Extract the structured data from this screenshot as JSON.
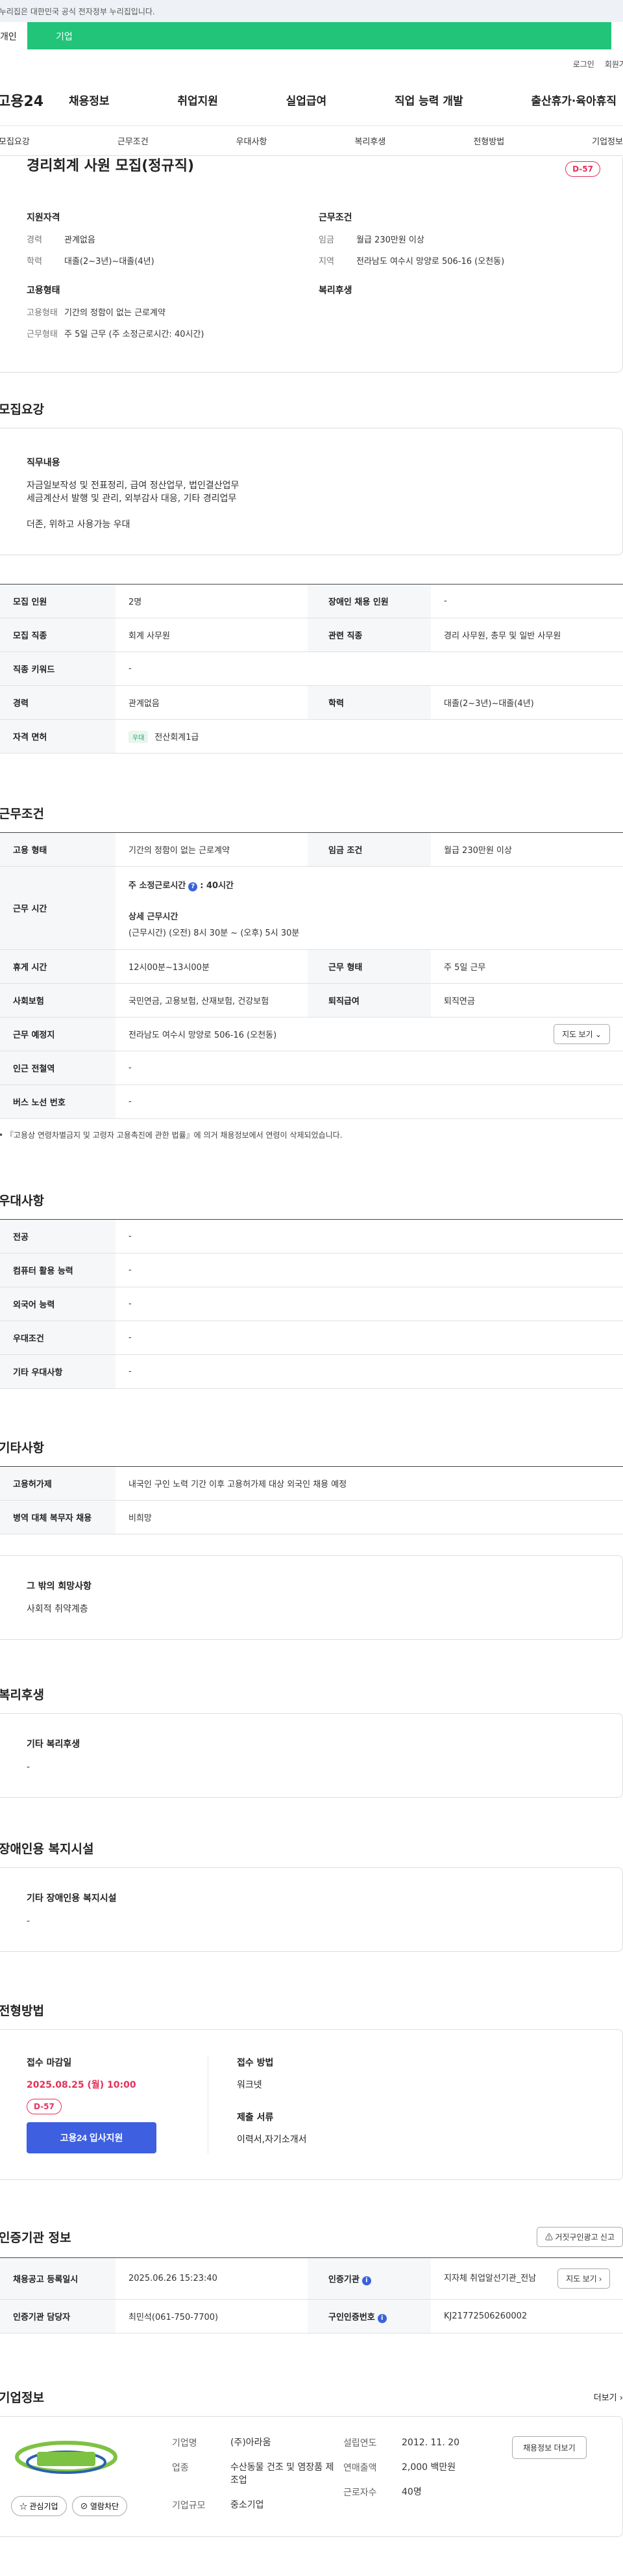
{
  "gov_banner": "이 누리집은 대한민국 공식 전자정부 누리집입니다.",
  "user_tabs": [
    "개인",
    "기업"
  ],
  "util_links": [
    "로그인",
    "회원가입"
  ],
  "gnb": {
    "logo": "고용24",
    "menu": [
      "채용정보",
      "취업지원",
      "실업급여",
      "직업 능력 개발",
      "출산휴가·육아휴직"
    ]
  },
  "subnav": [
    "모집요강",
    "근무조건",
    "우대사항",
    "복리후생",
    "전형방법",
    "기업정보"
  ],
  "summary": {
    "title": "경리회계 사원 모집(정규직)",
    "dday": "D-57",
    "qualification": {
      "heading": "지원자격",
      "rows": [
        {
          "k": "경력",
          "v": "관계없음"
        },
        {
          "k": "학력",
          "v": "대졸(2~3년)~대졸(4년)"
        }
      ]
    },
    "employment": {
      "heading": "고용형태",
      "rows": [
        {
          "k": "고용형태",
          "v": "기간의 정함이 없는 근로계약"
        },
        {
          "k": "근무형태",
          "v": "주 5일 근무 (주 소정근로시간: 40시간)"
        }
      ]
    },
    "conditions": {
      "heading": "근무조건",
      "rows": [
        {
          "k": "임금",
          "v": "월급 230만원 이상"
        },
        {
          "k": "지역",
          "v": "전라남도 여수시 망양로 506-16 (오천동)"
        }
      ]
    },
    "welfare": {
      "heading": "복리후생"
    }
  },
  "recruit": {
    "section_title": "모집요강",
    "job_head": "직무내용",
    "job_text": [
      "자금일보작성 및 전표정리, 급여 정산업무, 법인결산업무",
      "세금계산서 발행 및 관리, 외부감사 대응, 기타 경리업무",
      "",
      "더존, 위하고 사용가능 우대"
    ],
    "rows": [
      [
        {
          "th": "모집 인원",
          "td": "2명"
        },
        {
          "th": "장애인 채용 인원",
          "td": "-"
        }
      ],
      [
        {
          "th": "모집 직종",
          "td": "회계 사무원"
        },
        {
          "th": "관련 직종",
          "td": "경리 사무원, 총무 및 일반 사무원"
        }
      ],
      [
        {
          "th": "직종 키워드",
          "td": "-"
        }
      ],
      [
        {
          "th": "경력",
          "td": "관계없음"
        },
        {
          "th": "학력",
          "td": "대졸(2~3년)~대졸(4년)"
        }
      ],
      [
        {
          "th": "자격 면허",
          "td": "전산회계1급",
          "tag": "우대"
        }
      ]
    ]
  },
  "work": {
    "section_title": "근무조건",
    "employ_type": {
      "th": "고용 형태",
      "td": "기간의 정함이 없는 근로계약"
    },
    "wage": {
      "th": "임금 조건",
      "td": "월급 230만원 이상"
    },
    "hours": {
      "th": "근무 시간",
      "weekly_label": "주 소정근로시간",
      "weekly_value": ": 40시간",
      "detail_label": "상세 근무시간",
      "detail_value": "(근무시간) (오전) 8시 30분 ~ (오후) 5시 30분"
    },
    "break": {
      "th": "휴게 시간",
      "td": "12시00분~13시00분"
    },
    "work_form": {
      "th": "근무 형태",
      "td": "주 5일 근무"
    },
    "insurance": {
      "th": "사회보험",
      "td": "국민연금, 고용보험, 산재보험, 건강보험"
    },
    "retire": {
      "th": "퇴직급여",
      "td": "퇴직연금"
    },
    "place": {
      "th": "근무 예정지",
      "td": "전라남도 여수시 망양로 506-16 (오천동)",
      "btn": "지도 보기"
    },
    "subway": {
      "th": "인근 전철역",
      "td": "-"
    },
    "bus": {
      "th": "버스 노선 번호",
      "td": "-"
    },
    "notice": "『고용상 연령차별금지 및 고령자 고용촉진에 관한 법률』에 의거 채용정보에서 연령이 삭제되었습니다."
  },
  "preference": {
    "section_title": "우대사항",
    "rows": [
      {
        "th": "전공",
        "td": "-"
      },
      {
        "th": "컴퓨터 활용 능력",
        "td": "-"
      },
      {
        "th": "외국어 능력",
        "td": "-"
      },
      {
        "th": "우대조건",
        "td": "-"
      },
      {
        "th": "기타 우대사항",
        "td": "-"
      }
    ]
  },
  "etc": {
    "section_title": "기타사항",
    "rows": [
      {
        "th": "고용허가제",
        "td": "내국인 구인 노력 기간 이후 고용허가제 대상 외국인 채용 예정"
      },
      {
        "th": "병역 대체 복무자 채용",
        "td": "비희망"
      }
    ],
    "other_head": "그 밖의 희망사항",
    "other_text": "사회적 취약계층"
  },
  "welfare": {
    "section_title": "복리후생",
    "head": "기타 복리후생",
    "text": "-"
  },
  "disabled": {
    "section_title": "장애인용 복지시설",
    "head": "기타 장애인용 복지시설",
    "text": "-"
  },
  "selection": {
    "section_title": "전형방법",
    "deadline_label": "접수 마감일",
    "deadline": "2025.08.25 (월) 10:00",
    "dday": "D-57",
    "apply_btn": "고용24 입사지원",
    "method_label": "접수 방법",
    "method": "워크넷",
    "docs_label": "제출 서류",
    "docs": "이력서,자기소개서"
  },
  "cert": {
    "section_title": "인증기관 정보",
    "report_btn": "거짓구인광고 신고",
    "rows": [
      {
        "th": "채용공고 등록일시",
        "td": "2025.06.26 15:23:40",
        "th2": "인증기관",
        "td2": "지자체 취업알선기관_전남",
        "btn": "지도 보기"
      },
      {
        "th": "인증기관 담당자",
        "td": "최민석(061-750-7700)",
        "th2": "구인인증번호",
        "td2": "KJ21772506260002"
      }
    ]
  },
  "company": {
    "section_title": "기업정보",
    "more": "더보기",
    "interest_btn": "관심기업",
    "block_btn": "열람차단",
    "col1": [
      {
        "k": "기업명",
        "v": "(주)아라움"
      },
      {
        "k": "업종",
        "v": "수산동물 건조 및 염장품 제조업"
      },
      {
        "k": "기업규모",
        "v": "중소기업"
      }
    ],
    "col2": [
      {
        "k": "설립연도",
        "v": "2012. 11. 20"
      },
      {
        "k": "연매출액",
        "v": "2,000 백만원"
      },
      {
        "k": "근로자수",
        "v": "40명"
      }
    ],
    "hiring_btn": "채용정보 더보기",
    "colors": {
      "logo_green": "#7dc242",
      "logo_blue": "#2a62b0"
    }
  },
  "colors": {
    "accent_green": "#22c47a",
    "dday_red": "#e4315a",
    "apply_blue": "#3d5fe0"
  }
}
